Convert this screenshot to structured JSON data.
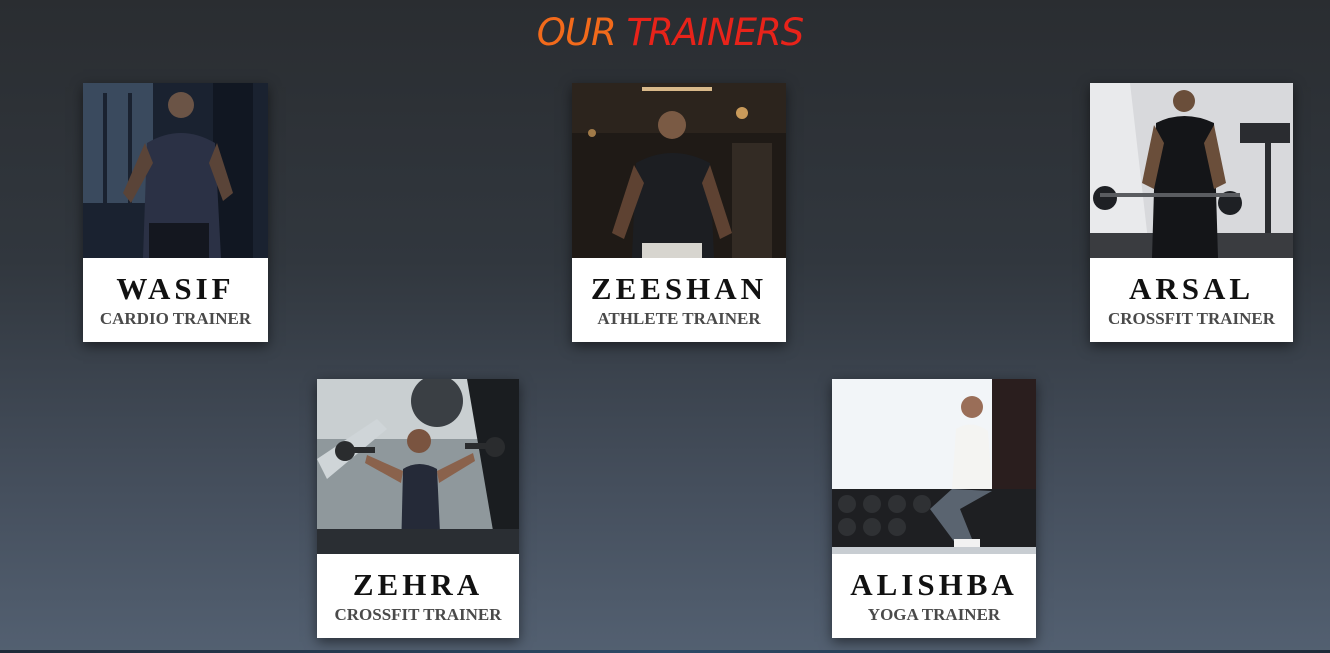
{
  "header": {
    "title_part1": "OUR",
    "title_part2": "TRAINERS"
  },
  "trainers": [
    {
      "name": "WASIF",
      "role": "CARDIO TRAINER"
    },
    {
      "name": "ZEESHAN",
      "role": "ATHLETE TRAINER"
    },
    {
      "name": "ARSAL",
      "role": "CROSSFIT TRAINER"
    },
    {
      "name": "ZEHRA",
      "role": "CROSSFIT TRAINER"
    },
    {
      "name": "ALISHBA",
      "role": "YOGA TRAINER"
    }
  ],
  "colors": {
    "title_our": "#f26a1b",
    "title_trainers": "#e8231a",
    "card_background": "#ffffff"
  }
}
